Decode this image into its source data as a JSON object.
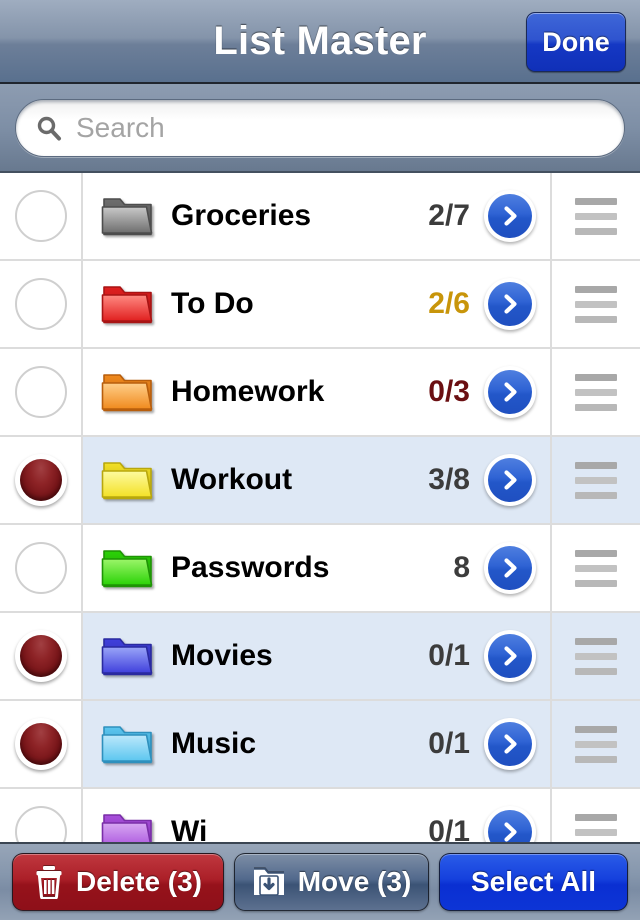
{
  "navbar": {
    "title": "List Master",
    "done_label": "Done"
  },
  "search": {
    "placeholder": "Search",
    "value": "",
    "icon": "search-icon"
  },
  "list": {
    "rows": [
      {
        "name": "Groceries",
        "count": "2/7",
        "count_color": "#3c3c3c",
        "folder_color": "gray",
        "selected": false,
        "checkbox": "unchecked"
      },
      {
        "name": "To Do",
        "count": "2/6",
        "count_color": "#c8950a",
        "folder_color": "red",
        "selected": false,
        "checkbox": "unchecked"
      },
      {
        "name": "Homework",
        "count": "0/3",
        "count_color": "#6b0f12",
        "folder_color": "orange",
        "selected": false,
        "checkbox": "unchecked"
      },
      {
        "name": "Workout",
        "count": "3/8",
        "count_color": "#3c3c3c",
        "folder_color": "yellow",
        "selected": true,
        "checkbox": "checked"
      },
      {
        "name": "Passwords",
        "count": "8",
        "count_color": "#3c3c3c",
        "folder_color": "green",
        "selected": false,
        "checkbox": "unchecked"
      },
      {
        "name": "Movies",
        "count": "0/1",
        "count_color": "#3c3c3c",
        "folder_color": "blue",
        "selected": true,
        "checkbox": "checked"
      },
      {
        "name": "Music",
        "count": "0/1",
        "count_color": "#3c3c3c",
        "folder_color": "cyan",
        "selected": true,
        "checkbox": "checked"
      },
      {
        "name": "Wi",
        "count": "0/1",
        "count_color": "#3c3c3c",
        "folder_color": "purple",
        "selected": false,
        "checkbox": "unchecked"
      }
    ]
  },
  "toolbar": {
    "delete_label": "Delete (3)",
    "move_label": "Move (3)",
    "select_all_label": "Select All",
    "delete_icon": "trash-icon",
    "move_icon": "folder-download-icon"
  },
  "colors": {
    "accent_blue": "#1540dd",
    "delete_red": "#ab1f28",
    "selected_row": "#dee8f5",
    "nav_gradient_top": "#9fadc0",
    "nav_gradient_bottom": "#59708e"
  },
  "folder_palette": {
    "gray": {
      "light": "#c9c9c9",
      "dark": "#6e6e6e",
      "edge": "#4d4d4d"
    },
    "red": {
      "light": "#ff8a82",
      "dark": "#e01f1f",
      "edge": "#a81414"
    },
    "orange": {
      "light": "#ffcf8a",
      "dark": "#f08a1e",
      "edge": "#b85e0c"
    },
    "yellow": {
      "light": "#fdfba0",
      "dark": "#f3e026",
      "edge": "#b8a70d"
    },
    "green": {
      "light": "#9cf56a",
      "dark": "#2bd207",
      "edge": "#1e9405"
    },
    "blue": {
      "light": "#9aa5f8",
      "dark": "#4040dc",
      "edge": "#2a2aa0"
    },
    "cyan": {
      "light": "#bde8fb",
      "dark": "#5cc6ef",
      "edge": "#2e90bd"
    },
    "purple": {
      "light": "#d7a8f2",
      "dark": "#a84fdc",
      "edge": "#7a2ea8"
    }
  }
}
